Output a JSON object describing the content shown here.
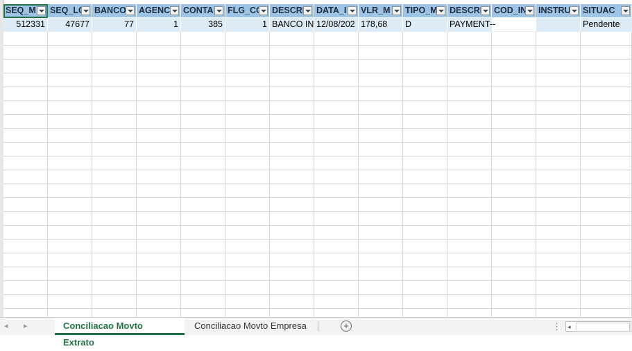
{
  "table": {
    "headers": [
      "SEQ_M",
      "SEQ_LC",
      "BANCO",
      "AGENC",
      "CONTA",
      "FLG_CC",
      "DESCRI",
      "DATA_I",
      "VLR_M",
      "TIPO_M",
      "DESCRI",
      "COD_IN",
      "INSTRU",
      "SITUAC"
    ],
    "row": [
      "512331",
      "47677",
      "77",
      "1",
      "385",
      "1",
      "BANCO IN",
      "12/08/202",
      "178,68",
      "D",
      "PAYMENT--",
      "",
      "",
      "Pendente"
    ]
  },
  "tabs": {
    "nav_prev": "◂",
    "nav_next": "▸",
    "sheet1": "Conciliacao Movto Extrato",
    "sheet2": "Conciliacao Movto Empresa",
    "add": "+",
    "more": "⋮",
    "scroll_left": "◂"
  }
}
